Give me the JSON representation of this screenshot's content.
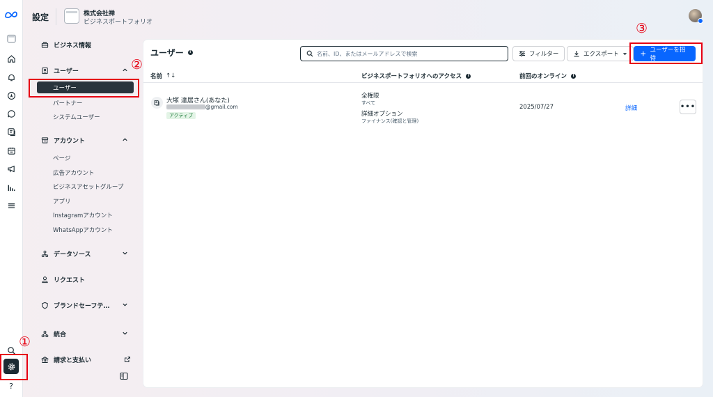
{
  "topbar": {
    "title": "設定",
    "portfolio_name": "株式会社禅",
    "portfolio_sub": "ビジネスポートフォリオ"
  },
  "rail": {
    "icons": [
      "meta-logo-icon",
      "business-portfolio-icon",
      "home-icon",
      "bell-icon",
      "compass-icon",
      "chat-icon",
      "pages-icon",
      "calendar-icon",
      "megaphone-icon",
      "insights-icon",
      "menu-icon",
      "search-icon",
      "gear-icon",
      "help-icon"
    ],
    "help_label": "?"
  },
  "sidebar": {
    "business_info": "ビジネス情報",
    "users_section": "ユーザー",
    "users_items": [
      "ユーザー",
      "パートナー",
      "システムユーザー"
    ],
    "accounts_section": "アカウント",
    "accounts_items": [
      "ページ",
      "広告アカウント",
      "ビジネスアセットグループ",
      "アプリ",
      "Instagramアカウント",
      "WhatsAppアカウント"
    ],
    "data_sources": "データソース",
    "requests": "リクエスト",
    "brand_safety": "ブランドセーフテ…",
    "integrations": "統合",
    "billing": "請求と支払い"
  },
  "main": {
    "title": "ユーザー",
    "search_placeholder": "名前、ID、またはメールアドレスで検索",
    "filter_label": "フィルター",
    "export_label": "エクスポート",
    "invite_label": "ユーザーを招待",
    "columns": {
      "name": "名前",
      "access": "ビジネスポートフォリオへのアクセス",
      "last_online": "前回のオンライン"
    },
    "sort_glyph": "↑↓",
    "info_glyph": "i",
    "rows": [
      {
        "name": "大塚 達居さん(あなた)",
        "email_domain": "@gmail.com",
        "status": "アクティブ",
        "access_primary": "全権限",
        "access_primary_sub": "すべて",
        "access_detail": "詳細オプション",
        "access_detail_sub": "ファイナンス(確認と管理)",
        "last_online": "2025/07/27",
        "details_link": "詳細",
        "more_glyph": "•••"
      }
    ]
  },
  "annotations": {
    "markers": [
      "①",
      "②",
      "③"
    ],
    "color": "#e60012"
  },
  "colors": {
    "primary": "#0866ff",
    "selected_bg": "#29343d",
    "active_badge_bg": "#e3f4e6"
  }
}
